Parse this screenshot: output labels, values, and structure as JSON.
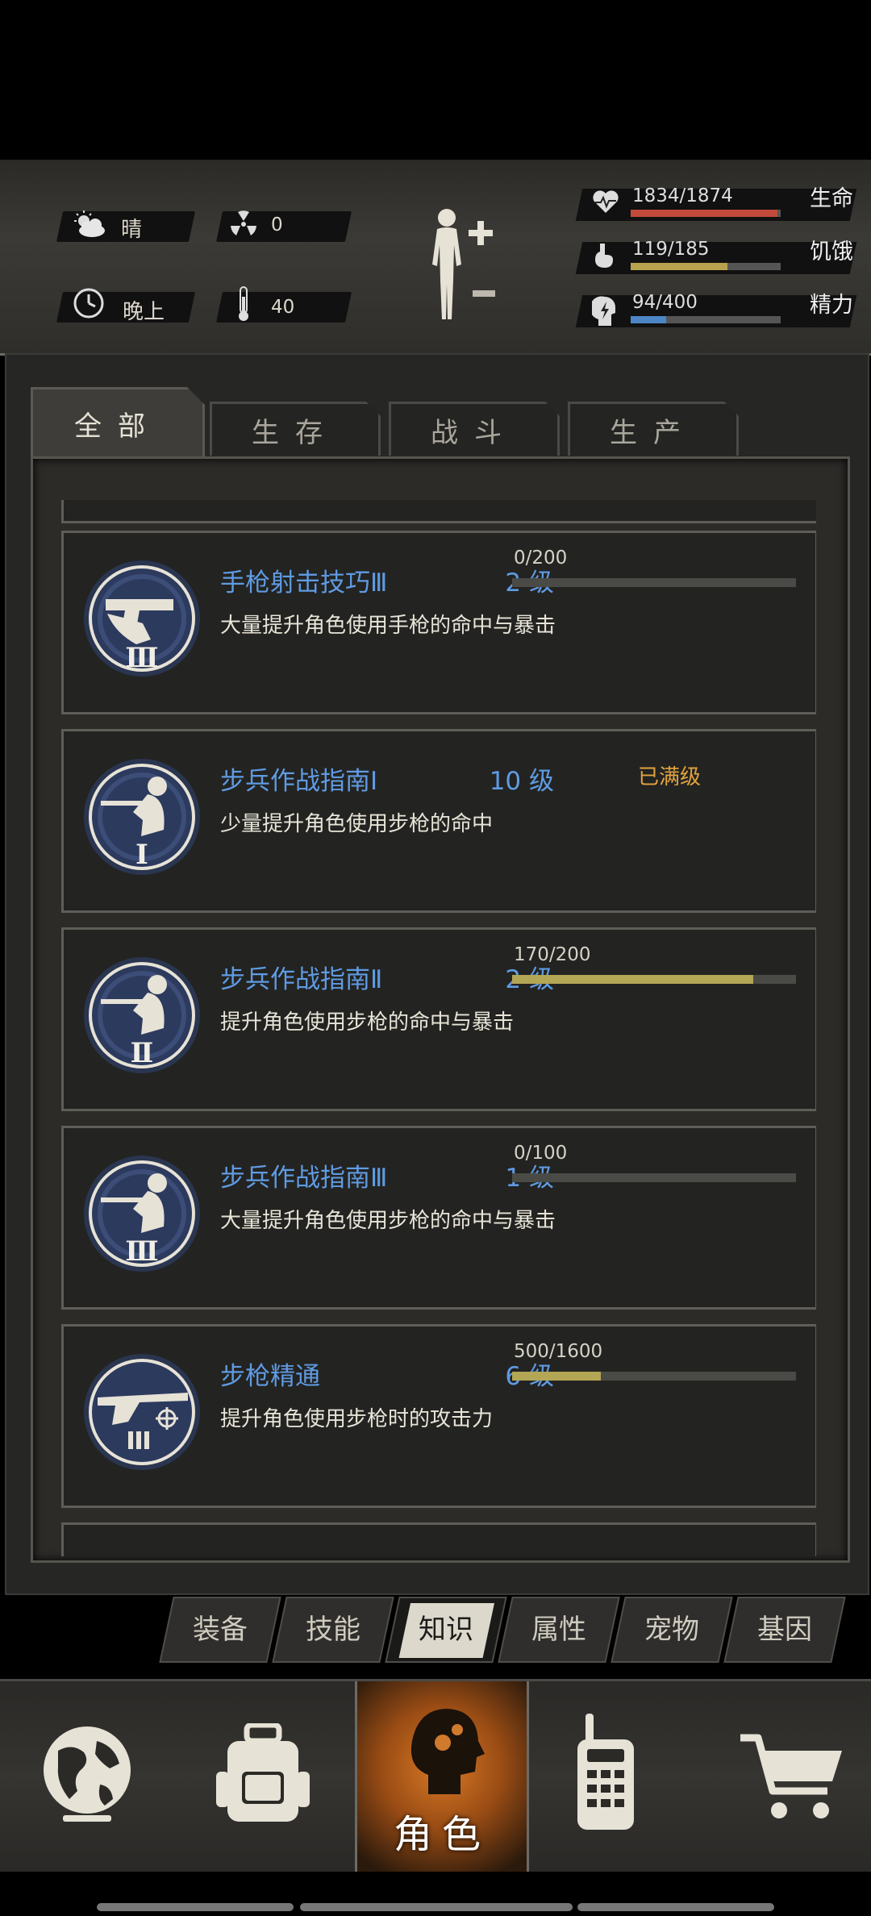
{
  "status": {
    "weather": "晴",
    "radiation": "0",
    "time_of_day": "晚上",
    "temperature": "40",
    "stats": [
      {
        "name": "生命",
        "value": "1834/1874",
        "fraction": 0.979,
        "color": "#c24a3a",
        "icon": "heart-pulse-icon"
      },
      {
        "name": "饥饿",
        "value": "119/185",
        "fraction": 0.643,
        "color": "#b8a24e",
        "icon": "stomach-icon"
      },
      {
        "name": "精力",
        "value": "94/400",
        "fraction": 0.235,
        "color": "#4d86c6",
        "icon": "energy-head-icon"
      }
    ]
  },
  "tabs": [
    "全部",
    "生存",
    "战斗",
    "生产"
  ],
  "active_tab": "全部",
  "skills": [
    {
      "name": "手枪射击技巧Ⅲ",
      "level": "2 级",
      "desc": "大量提升角色使用手枪的命中与暴击",
      "progress_text": "0/200",
      "fraction": 0.0,
      "icon": "pistol-badge-icon",
      "numeral": "Ⅲ"
    },
    {
      "name": "步兵作战指南Ⅰ",
      "level": "10 级",
      "desc": "少量提升角色使用步枪的命中",
      "progress_text": "",
      "max_label": "已满级",
      "icon": "rifleman-badge-icon",
      "numeral": "Ⅰ"
    },
    {
      "name": "步兵作战指南Ⅱ",
      "level": "2 级",
      "desc": "提升角色使用步枪的命中与暴击",
      "progress_text": "170/200",
      "fraction": 0.85,
      "icon": "rifleman-badge-icon",
      "numeral": "Ⅱ"
    },
    {
      "name": "步兵作战指南Ⅲ",
      "level": "1 级",
      "desc": "大量提升角色使用步枪的命中与暴击",
      "progress_text": "0/100",
      "fraction": 0.0,
      "icon": "rifleman-badge-icon",
      "numeral": "Ⅲ"
    },
    {
      "name": "步枪精通",
      "level": "6 级",
      "desc": "提升角色使用步枪时的攻击力",
      "progress_text": "500/1600",
      "fraction": 0.3125,
      "icon": "rifle-mastery-badge-icon",
      "numeral": ""
    }
  ],
  "subtabs": [
    "装备",
    "技能",
    "知识",
    "属性",
    "宠物",
    "基因"
  ],
  "active_subtab": "知识",
  "bottom_nav": {
    "active_label": "角色",
    "items": [
      "globe-icon",
      "backpack-icon",
      "character-icon",
      "radio-icon",
      "cart-icon"
    ]
  }
}
